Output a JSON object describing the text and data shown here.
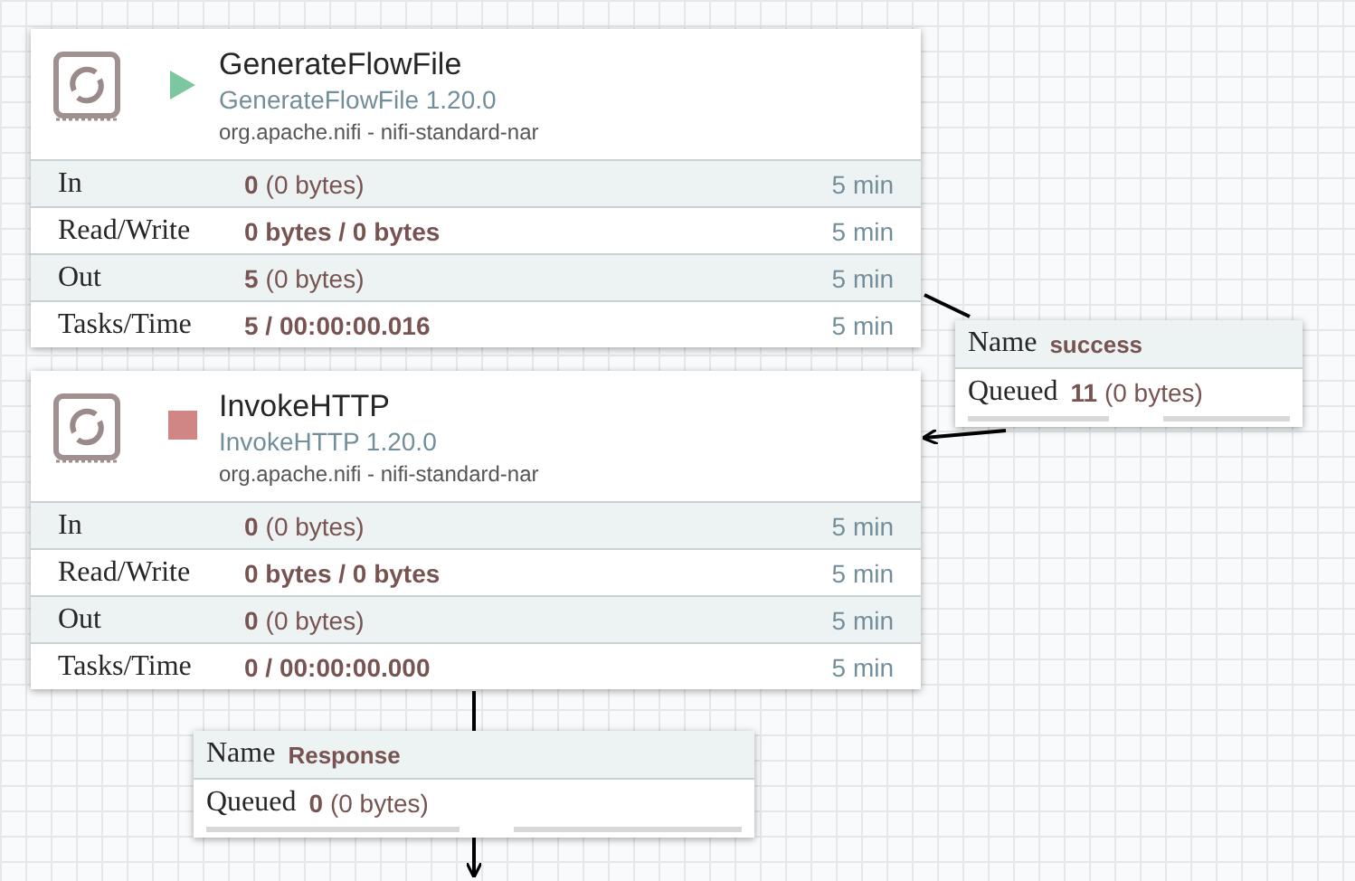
{
  "processors": [
    {
      "name": "GenerateFlowFile",
      "type": "GenerateFlowFile 1.20.0",
      "bundle": "org.apache.nifi - nifi-standard-nar",
      "running": true,
      "stats": [
        {
          "label": "In",
          "count": "0",
          "detail": "(0 bytes)",
          "window": "5 min"
        },
        {
          "label": "Read/Write",
          "count": "0 bytes / 0 bytes",
          "window": "5 min"
        },
        {
          "label": "Out",
          "count": "5",
          "detail": "(0 bytes)",
          "window": "5 min"
        },
        {
          "label": "Tasks/Time",
          "count": "5 / 00:00:00.016",
          "window": "5 min"
        }
      ]
    },
    {
      "name": "InvokeHTTP",
      "type": "InvokeHTTP 1.20.0",
      "bundle": "org.apache.nifi - nifi-standard-nar",
      "running": false,
      "stats": [
        {
          "label": "In",
          "count": "0",
          "detail": "(0 bytes)",
          "window": "5 min"
        },
        {
          "label": "Read/Write",
          "count": "0 bytes / 0 bytes",
          "window": "5 min"
        },
        {
          "label": "Out",
          "count": "0",
          "detail": "(0 bytes)",
          "window": "5 min"
        },
        {
          "label": "Tasks/Time",
          "count": "0 / 00:00:00.000",
          "window": "5 min"
        }
      ]
    }
  ],
  "connections": [
    {
      "name_label": "Name",
      "name": "success",
      "queued_label": "Queued",
      "count": "11",
      "detail": "(0 bytes)"
    },
    {
      "name_label": "Name",
      "name": "Response",
      "queued_label": "Queued",
      "count": "0",
      "detail": "(0 bytes)"
    }
  ]
}
